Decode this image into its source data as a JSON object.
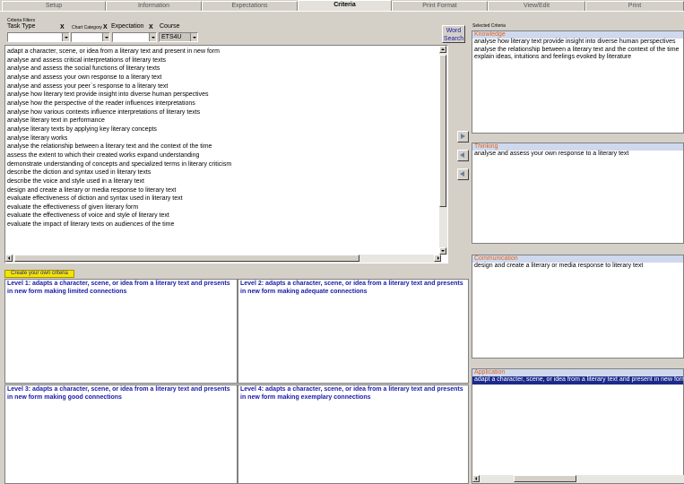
{
  "tabs": [
    "Setup",
    "Information",
    "Expectations",
    "Criteria",
    "Print Format",
    "View/Edit",
    "Print"
  ],
  "active_tab": "Criteria",
  "filters": {
    "heading": "Criteria Filters",
    "task_type_label": "Task Type",
    "chart_category_label": "Chart Category",
    "expectation_label": "Expectation",
    "course_label": "Course",
    "course_value": "ETS4U",
    "clear_glyph": "X"
  },
  "word_search": {
    "line1": "Word",
    "line2": "Search"
  },
  "criteria_list": [
    "adapt a character, scene, or idea from a literary text and present in new form",
    "analyse and assess critical interpretations of literary texts",
    "analyse and assess the social functions of literary texts",
    "analyse and assess your own response to a literary text",
    "analyse and assess your peer`s response to a literary text",
    "analyse how literary text provide insight into diverse human perspectives",
    "analyse how the perspective of the reader influences interpretations",
    "analyse how various contexts influence interpretations of literary texts",
    "analyse literary text in performance",
    "analyse literary texts by applying key literary concepts",
    "analyse literary works",
    "analyse the relationship between a literary text and the context of the time",
    "assess the extent to which their created works expand understanding",
    "demonstrate understanding of concepts and specialized terms in literary criticism",
    "describe the diction and syntax used in literary texts",
    "describe the voice and style used in a literary text",
    "design and create a literary or media response to literary text",
    "evaluate effectiveness of diction and syntax used in literary text",
    "evaluate the effectiveness of given literary form",
    "evaluate the effectiveness of voice and style of literary text",
    "evaluate the impact of literary texts on audiences of the time"
  ],
  "create_button": "Create your own criteria",
  "levels": [
    "Level 1: adapts a character, scene, or idea from a literary text and presents in new form making limited connections",
    "Level 2: adapts a character, scene, or idea from a literary text and presents in new form making adequate connections",
    "Level 3: adapts a character, scene, or idea from a literary text and presents in new form making good connections",
    "Level 4: adapts a character, scene, or idea from a literary text and presents in new form making exemplary connections"
  ],
  "selected": {
    "heading": "Selected Criteria",
    "knowledge": {
      "title": "Knowledge",
      "items": [
        "analyse how literary text provide insight into diverse human perspectives",
        "analyse the relationship between a literary text and the context of the time",
        "explain ideas, intuitions and feelings evoked by literature"
      ]
    },
    "thinking": {
      "title": "Thinking",
      "items": [
        "analyse and assess your own response to a literary text"
      ]
    },
    "communication": {
      "title": "Communication",
      "items": [
        "design and create a literary or media response to literary text"
      ]
    },
    "application": {
      "title": "Application",
      "items": [
        "adapt a character, scene, or idea from a literary text and present in new form"
      ]
    }
  },
  "colors": {
    "background": "#d4d0c8",
    "link_blue": "#1a1aa8",
    "section_orange": "#e06418",
    "selection": "#1c2a8a",
    "yellow_button": "#f4e400"
  }
}
